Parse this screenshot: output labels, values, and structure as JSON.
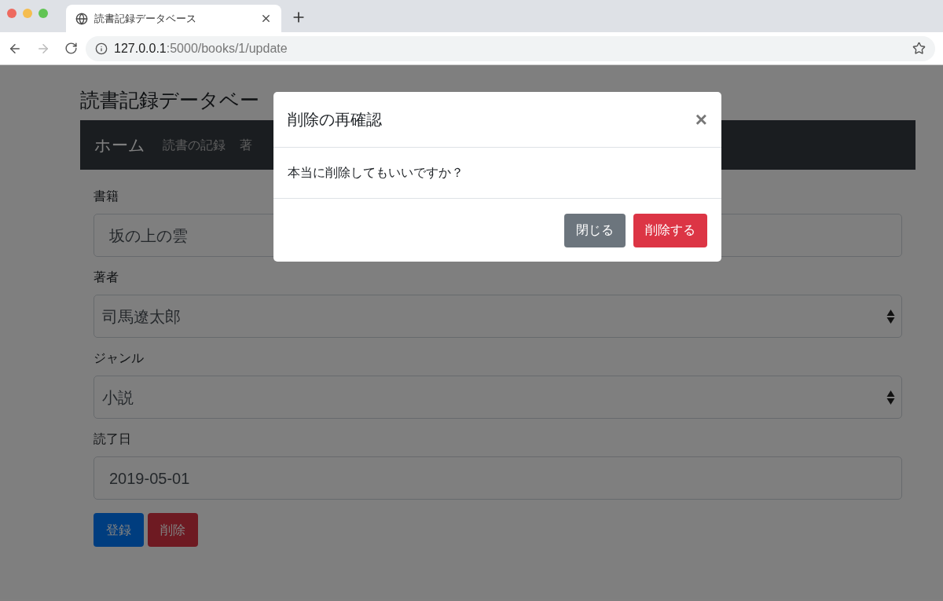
{
  "browser": {
    "tab_title": "読書記録データベース",
    "url_host": "127.0.0.1",
    "url_path": ":5000/books/1/update"
  },
  "page": {
    "title": "読書記録データベー",
    "nav": [
      {
        "label": "ホーム",
        "kind": "brand"
      },
      {
        "label": "読書の記録",
        "kind": "link"
      },
      {
        "label": "著",
        "kind": "link"
      }
    ],
    "fields": [
      {
        "label": "書籍",
        "kind": "input",
        "value": "坂の上の雲"
      },
      {
        "label": "著者",
        "kind": "select",
        "value": "司馬遼太郎"
      },
      {
        "label": "ジャンル",
        "kind": "select",
        "value": "小説"
      },
      {
        "label": "読了日",
        "kind": "input",
        "value": "2019-05-01"
      }
    ],
    "buttons": [
      {
        "label": "登録",
        "kind": "primary"
      },
      {
        "label": "削除",
        "kind": "danger"
      }
    ]
  },
  "modal": {
    "title": "削除の再確認",
    "close": "×",
    "body": "本当に削除してもいいですか？",
    "buttons": [
      {
        "label": "閉じる",
        "kind": "secondary"
      },
      {
        "label": "削除する",
        "kind": "danger"
      }
    ]
  }
}
